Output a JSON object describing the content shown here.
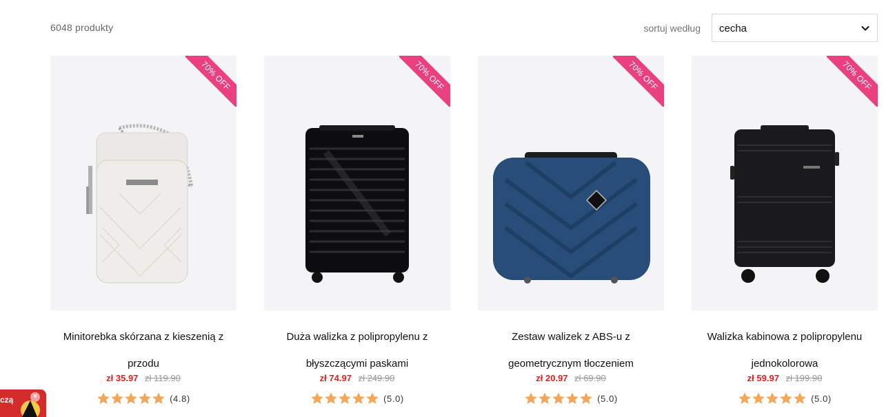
{
  "toolbar": {
    "product_count": "6048 produkty",
    "sort_label": "sortuj według",
    "sort_selected": "cecha"
  },
  "colors": {
    "badge": "#e9407f",
    "price_now": "#e02020",
    "star": "#f2a65a",
    "tile_bg": "#f4f4f6"
  },
  "products": [
    {
      "badge": "70% OFF",
      "title": "Minitorebka skórzana z kieszenią z przodu",
      "price_now": "zł 35.97",
      "price_old": "zł 119.90",
      "rating_value": 4.8,
      "rating_text": "(4.8)",
      "image_icon": "white-quilted-crossbody-bag"
    },
    {
      "badge": "70% OFF",
      "title": "Duża walizka z polipropylenu z błyszczącymi paskami",
      "price_now": "zł 74.97",
      "price_old": "zł 249.90",
      "rating_value": 5.0,
      "rating_text": "(5.0)",
      "image_icon": "black-ribbed-suitcase"
    },
    {
      "badge": "70% OFF",
      "title": "Zestaw walizek z ABS-u z geometrycznym tłoczeniem",
      "price_now": "zł 20.97",
      "price_old": "zł 69.90",
      "rating_value": 5.0,
      "rating_text": "(5.0)",
      "image_icon": "blue-geometric-beauty-case"
    },
    {
      "badge": "70% OFF",
      "title": "Walizka kabinowa z polipropylenu jednokolorowa",
      "price_now": "zł 59.97",
      "price_old": "zł 199.90",
      "rating_value": 5.0,
      "rating_text": "(5.0)",
      "image_icon": "black-cabin-suitcase"
    }
  ],
  "promo": {
    "text": "czą",
    "close_symbol": "×"
  }
}
